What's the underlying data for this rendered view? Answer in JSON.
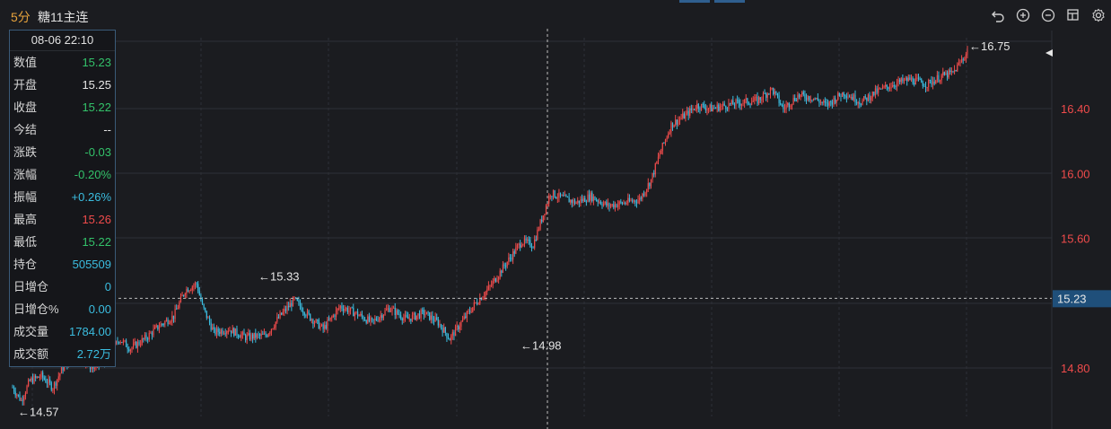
{
  "header": {
    "period": "5分",
    "symbol": "糖11主连"
  },
  "toolbar": {
    "icons": [
      "undo-icon",
      "zoom-in-icon",
      "zoom-out-icon",
      "layout-icon",
      "settings-icon"
    ]
  },
  "colors": {
    "background": "#1b1c20",
    "up": "#ef4b4b",
    "down": "#3bbde0",
    "grid": "#2e3037",
    "axis_text": "#ef4b4b",
    "current_price_bg": "#1f4f7a"
  },
  "info_panel": {
    "time": "08-06 22:10",
    "rows": [
      {
        "label": "数值",
        "value": "15.23",
        "tone": "dn"
      },
      {
        "label": "开盘",
        "value": "15.25",
        "tone": "neu"
      },
      {
        "label": "收盘",
        "value": "15.22",
        "tone": "dn"
      },
      {
        "label": "今结",
        "value": "--",
        "tone": "neu"
      },
      {
        "label": "涨跌",
        "value": "-0.03",
        "tone": "dn"
      },
      {
        "label": "涨幅",
        "value": "-0.20%",
        "tone": "dn"
      },
      {
        "label": "振幅",
        "value": "+0.26%",
        "tone": "cy"
      },
      {
        "label": "最高",
        "value": "15.26",
        "tone": "up"
      },
      {
        "label": "最低",
        "value": "15.22",
        "tone": "dn"
      },
      {
        "label": "持仓",
        "value": "505509",
        "tone": "cy"
      },
      {
        "label": "日增仓",
        "value": "0",
        "tone": "cy"
      },
      {
        "label": "日增仓%",
        "value": "0.00",
        "tone": "cy"
      },
      {
        "label": "成交量",
        "value": "1784.00",
        "tone": "cy"
      },
      {
        "label": "成交额",
        "value": "2.72万",
        "tone": "cy"
      }
    ]
  },
  "chart_data": {
    "type": "candlestick",
    "y_ticks": [
      "14.80",
      "15.60",
      "16.00",
      "16.40"
    ],
    "ylim": [
      14.55,
      16.85
    ],
    "crosshair_price": "15.23",
    "current_price_marker": "",
    "annotations": [
      {
        "text": "←14.57",
        "price": 14.57,
        "kind": "low"
      },
      {
        "text": "←14.98",
        "price": 14.98,
        "kind": "low"
      },
      {
        "text": "←15.33",
        "price": 15.33,
        "kind": "high"
      },
      {
        "text": "←16.75",
        "price": 16.75,
        "kind": "high"
      }
    ],
    "anchors": [
      [
        0,
        14.68
      ],
      [
        6,
        14.6
      ],
      [
        12,
        14.72
      ],
      [
        20,
        14.75
      ],
      [
        28,
        14.68
      ],
      [
        36,
        14.82
      ],
      [
        46,
        14.86
      ],
      [
        56,
        14.8
      ],
      [
        66,
        14.85
      ],
      [
        74,
        14.98
      ],
      [
        82,
        14.92
      ],
      [
        92,
        14.98
      ],
      [
        102,
        15.06
      ],
      [
        112,
        15.12
      ],
      [
        120,
        15.28
      ],
      [
        128,
        15.32
      ],
      [
        132,
        15.18
      ],
      [
        140,
        15.02
      ],
      [
        150,
        15.04
      ],
      [
        162,
        14.99
      ],
      [
        176,
        15.0
      ],
      [
        186,
        15.12
      ],
      [
        196,
        15.22
      ],
      [
        206,
        15.12
      ],
      [
        216,
        15.04
      ],
      [
        228,
        15.18
      ],
      [
        238,
        15.14
      ],
      [
        250,
        15.08
      ],
      [
        262,
        15.17
      ],
      [
        274,
        15.1
      ],
      [
        286,
        15.14
      ],
      [
        296,
        15.08
      ],
      [
        304,
        14.98
      ],
      [
        312,
        15.08
      ],
      [
        322,
        15.2
      ],
      [
        332,
        15.3
      ],
      [
        338,
        15.38
      ],
      [
        346,
        15.48
      ],
      [
        354,
        15.58
      ],
      [
        362,
        15.56
      ],
      [
        368,
        15.72
      ],
      [
        374,
        15.88
      ],
      [
        382,
        15.85
      ],
      [
        392,
        15.82
      ],
      [
        402,
        15.86
      ],
      [
        414,
        15.8
      ],
      [
        426,
        15.82
      ],
      [
        436,
        15.84
      ],
      [
        444,
        15.96
      ],
      [
        450,
        16.12
      ],
      [
        458,
        16.3
      ],
      [
        468,
        16.36
      ],
      [
        476,
        16.42
      ],
      [
        486,
        16.4
      ],
      [
        496,
        16.42
      ],
      [
        508,
        16.44
      ],
      [
        518,
        16.45
      ],
      [
        528,
        16.52
      ],
      [
        536,
        16.4
      ],
      [
        546,
        16.48
      ],
      [
        556,
        16.47
      ],
      [
        566,
        16.42
      ],
      [
        578,
        16.5
      ],
      [
        590,
        16.44
      ],
      [
        600,
        16.5
      ],
      [
        612,
        16.55
      ],
      [
        624,
        16.58
      ],
      [
        636,
        16.55
      ],
      [
        646,
        16.6
      ],
      [
        654,
        16.62
      ],
      [
        664,
        16.75
      ]
    ]
  }
}
